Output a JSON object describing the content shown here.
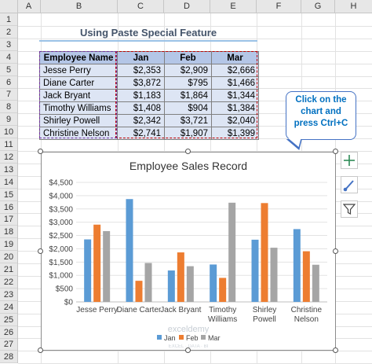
{
  "columns": [
    "A",
    "B",
    "C",
    "D",
    "E",
    "F",
    "G",
    "H"
  ],
  "rows": [
    "1",
    "2",
    "3",
    "4",
    "5",
    "6",
    "7",
    "8",
    "9",
    "10",
    "11",
    "12",
    "13",
    "14",
    "15",
    "16",
    "17",
    "18",
    "19",
    "20",
    "21",
    "22",
    "23",
    "24",
    "25",
    "26",
    "27",
    "28"
  ],
  "sheet": {
    "title": "Using Paste Special Feature",
    "table": {
      "headers": [
        "Employee Name",
        "Jan",
        "Feb",
        "Mar"
      ],
      "rows": [
        [
          "Jesse Perry",
          "$2,353",
          "$2,909",
          "$2,666"
        ],
        [
          "Diane Carter",
          "$3,872",
          "$795",
          "$1,466"
        ],
        [
          "Jack Bryant",
          "$1,183",
          "$1,864",
          "$1,344"
        ],
        [
          "Timothy Williams",
          "$1,408",
          "$904",
          "$1,384"
        ],
        [
          "Shirley Powell",
          "$2,342",
          "$3,721",
          "$2,040"
        ],
        [
          "Christine Nelson",
          "$2,741",
          "$1,907",
          "$1,399"
        ]
      ]
    }
  },
  "callout": {
    "line1": "Click on the",
    "line2": "chart and",
    "line3": "press Ctrl+C"
  },
  "side_buttons": {
    "add": "chart-elements-icon",
    "style": "brush-icon",
    "filter": "filter-icon"
  },
  "watermark": {
    "text": "exceldemy",
    "sub": "EXCEL · DATA · BI"
  },
  "chart_data": {
    "type": "bar",
    "title": "Employee Sales Record",
    "categories": [
      "Jesse Perry",
      "Diane Carter",
      "Jack Bryant",
      "Timothy Williams",
      "Shirley Powell",
      "Christine Nelson"
    ],
    "category_lines": [
      [
        "Jesse Perry"
      ],
      [
        "Diane Carter"
      ],
      [
        "Jack Bryant"
      ],
      [
        "Timothy",
        "Williams"
      ],
      [
        "Shirley",
        "Powell"
      ],
      [
        "Christine",
        "Nelson"
      ]
    ],
    "series": [
      {
        "name": "Jan",
        "color": "#5b9bd5",
        "values": [
          2353,
          3872,
          1183,
          1408,
          2342,
          2741
        ]
      },
      {
        "name": "Feb",
        "color": "#ed7d31",
        "values": [
          2909,
          795,
          1864,
          904,
          3721,
          1907
        ]
      },
      {
        "name": "Mar",
        "color": "#a5a5a5",
        "values": [
          2666,
          1466,
          1344,
          3735,
          2040,
          1399
        ]
      }
    ],
    "ylim": [
      0,
      4500
    ],
    "yticks": [
      "$0",
      "$500",
      "$1,000",
      "$1,500",
      "$2,000",
      "$2,500",
      "$3,000",
      "$3,500",
      "$4,000",
      "$4,500"
    ],
    "grid": true,
    "legend": "bottom"
  }
}
